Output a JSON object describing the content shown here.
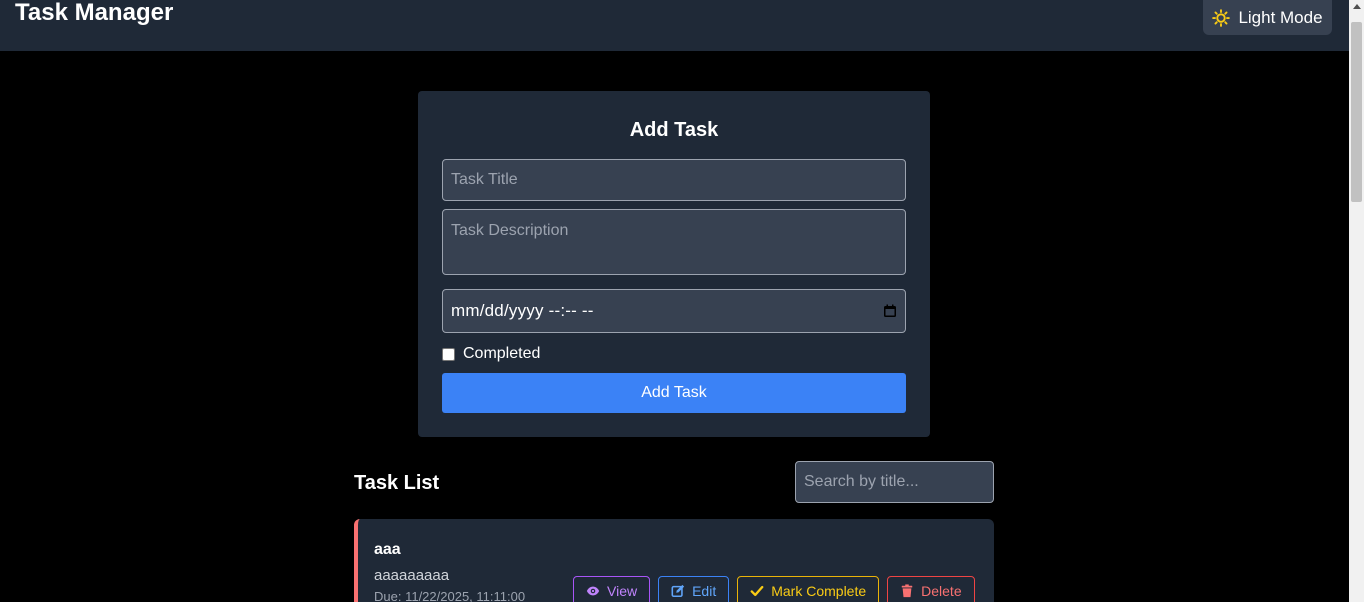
{
  "header": {
    "title": "Task Manager",
    "theme_toggle_label": "Light Mode",
    "theme_icon": "sun-icon"
  },
  "form": {
    "title": "Add Task",
    "title_placeholder": "Task Title",
    "description_placeholder": "Task Description",
    "due_placeholder": "mm/dd/yyyy --:-- --",
    "completed_label": "Completed",
    "submit_label": "Add Task"
  },
  "list": {
    "title": "Task List",
    "search_placeholder": "Search by title..."
  },
  "tasks": [
    {
      "title": "aaa",
      "description": "aaaaaaaaa",
      "due": "Due: 11/22/2025, 11:11:00",
      "actions": {
        "view": "View",
        "edit": "Edit",
        "complete": "Mark Complete",
        "delete": "Delete"
      }
    }
  ],
  "colors": {
    "accent": "#3b82f6",
    "surface": "#1f2937",
    "background": "#000000",
    "overdue_border": "#f87171"
  }
}
